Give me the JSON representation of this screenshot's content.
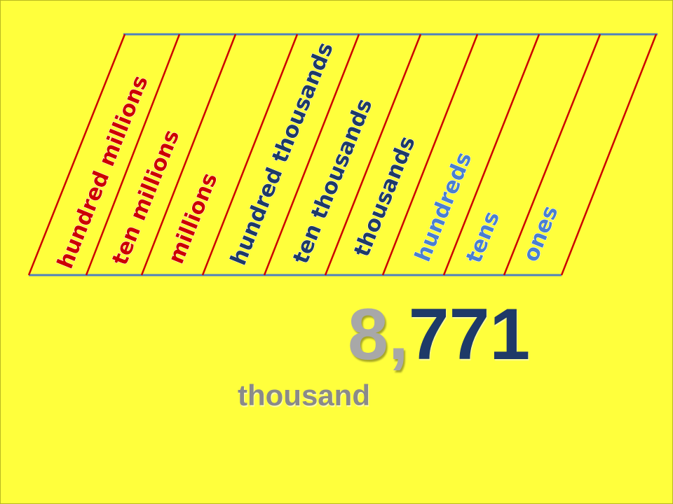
{
  "place_value_chart": {
    "columns": [
      {
        "label": "hundred millions",
        "color": "#cc0000"
      },
      {
        "label": "ten millions",
        "color": "#cc0000"
      },
      {
        "label": "millions",
        "color": "#cc0000"
      },
      {
        "label": "hundred thousands",
        "color": "#1e3a68"
      },
      {
        "label": "ten thousands",
        "color": "#1e3a68"
      },
      {
        "label": "thousands",
        "color": "#1e3a68"
      },
      {
        "label": "hundreds",
        "color": "#4a7fd0"
      },
      {
        "label": "tens",
        "color": "#4a7fd0"
      },
      {
        "label": "ones",
        "color": "#4a7fd0"
      }
    ],
    "divider_color": "#cc0000",
    "border_color": "#4f81bd"
  },
  "number": {
    "thousands_digit": "8",
    "separator": ",",
    "remaining_digits": "771"
  },
  "period_label": "thousand"
}
